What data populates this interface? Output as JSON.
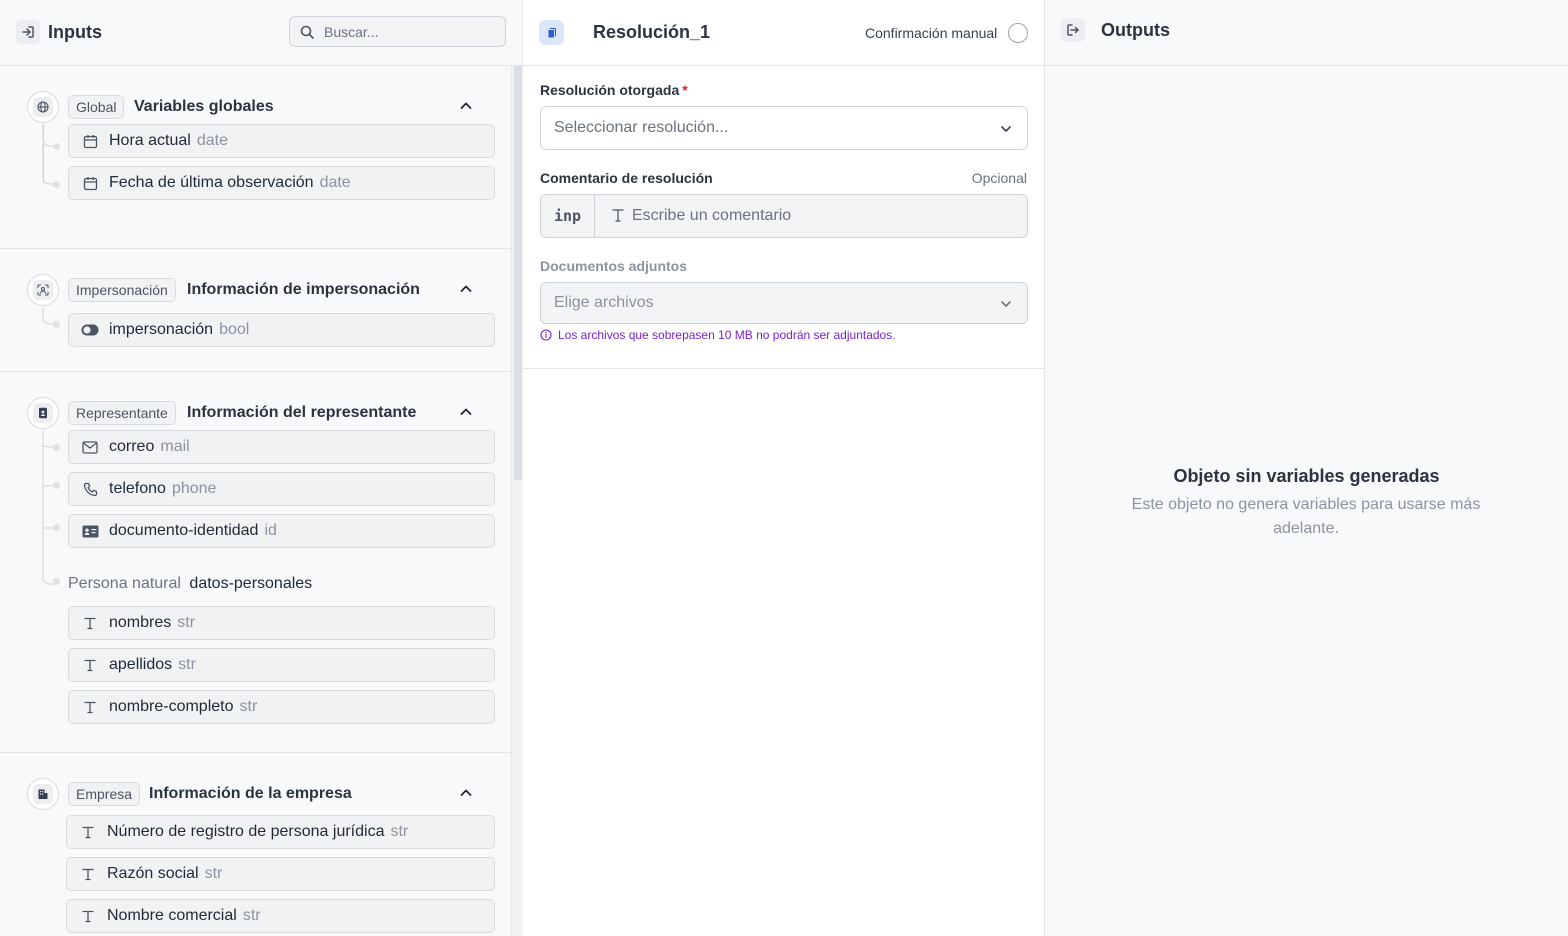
{
  "inputs": {
    "title": "Inputs",
    "search_placeholder": "Buscar...",
    "groups": [
      {
        "tag": "Global",
        "title": "Variables globales",
        "icon": "globe-icon",
        "vars": [
          {
            "name": "Hora actual",
            "type": "date",
            "icon": "calendar-icon"
          },
          {
            "name": "Fecha de última observación",
            "type": "date",
            "icon": "calendar-icon"
          }
        ]
      },
      {
        "tag": "Impersonación",
        "title": "Información de impersonación",
        "icon": "face-scan-icon",
        "vars": [
          {
            "name": "impersonación",
            "type": "bool",
            "icon": "toggle-icon"
          }
        ]
      },
      {
        "tag": "Representante",
        "title": "Información del representante",
        "icon": "id-badge-icon",
        "vars": [
          {
            "name": "correo",
            "type": "mail",
            "icon": "mail-icon"
          },
          {
            "name": "telefono",
            "type": "phone",
            "icon": "phone-icon"
          },
          {
            "name": "documento-identidad",
            "type": "id",
            "icon": "id-card-icon"
          }
        ],
        "subgroup": {
          "label": "Persona natural",
          "key": "datos-personales",
          "vars": [
            {
              "name": "nombres",
              "type": "str",
              "icon": "text-icon"
            },
            {
              "name": "apellidos",
              "type": "str",
              "icon": "text-icon"
            },
            {
              "name": "nombre-completo",
              "type": "str",
              "icon": "text-icon"
            }
          ]
        }
      },
      {
        "tag": "Empresa",
        "title": "Información de la empresa",
        "icon": "building-icon",
        "vars": [
          {
            "name": "Número de registro de persona jurídica",
            "type": "str",
            "icon": "text-icon"
          },
          {
            "name": "Razón social",
            "type": "str",
            "icon": "text-icon"
          },
          {
            "name": "Nombre comercial",
            "type": "str",
            "icon": "text-icon"
          }
        ]
      }
    ]
  },
  "editor": {
    "title": "Resolución_1",
    "manual_label": "Confirmación manual",
    "fields": {
      "resolution_label": "Resolución otorgada",
      "resolution_required": "*",
      "resolution_placeholder": "Seleccionar resolución...",
      "comment_label": "Comentario de resolución",
      "comment_optional": "Opcional",
      "comment_prefix": "inp",
      "comment_placeholder": "Escribe un comentario",
      "docs_label": "Documentos adjuntos",
      "docs_placeholder": "Elige archivos",
      "docs_hint": "Los archivos que sobrepasen 10 MB no podrán ser adjuntados."
    }
  },
  "outputs": {
    "title": "Outputs",
    "empty_title": "Objeto sin variables generadas",
    "empty_desc": "Este objeto no genera variables para usarse más adelante."
  },
  "colors": {
    "accent_blue": "#2f5fd0",
    "hint_purple": "#7c1fd6",
    "required_red": "#dc2626"
  }
}
